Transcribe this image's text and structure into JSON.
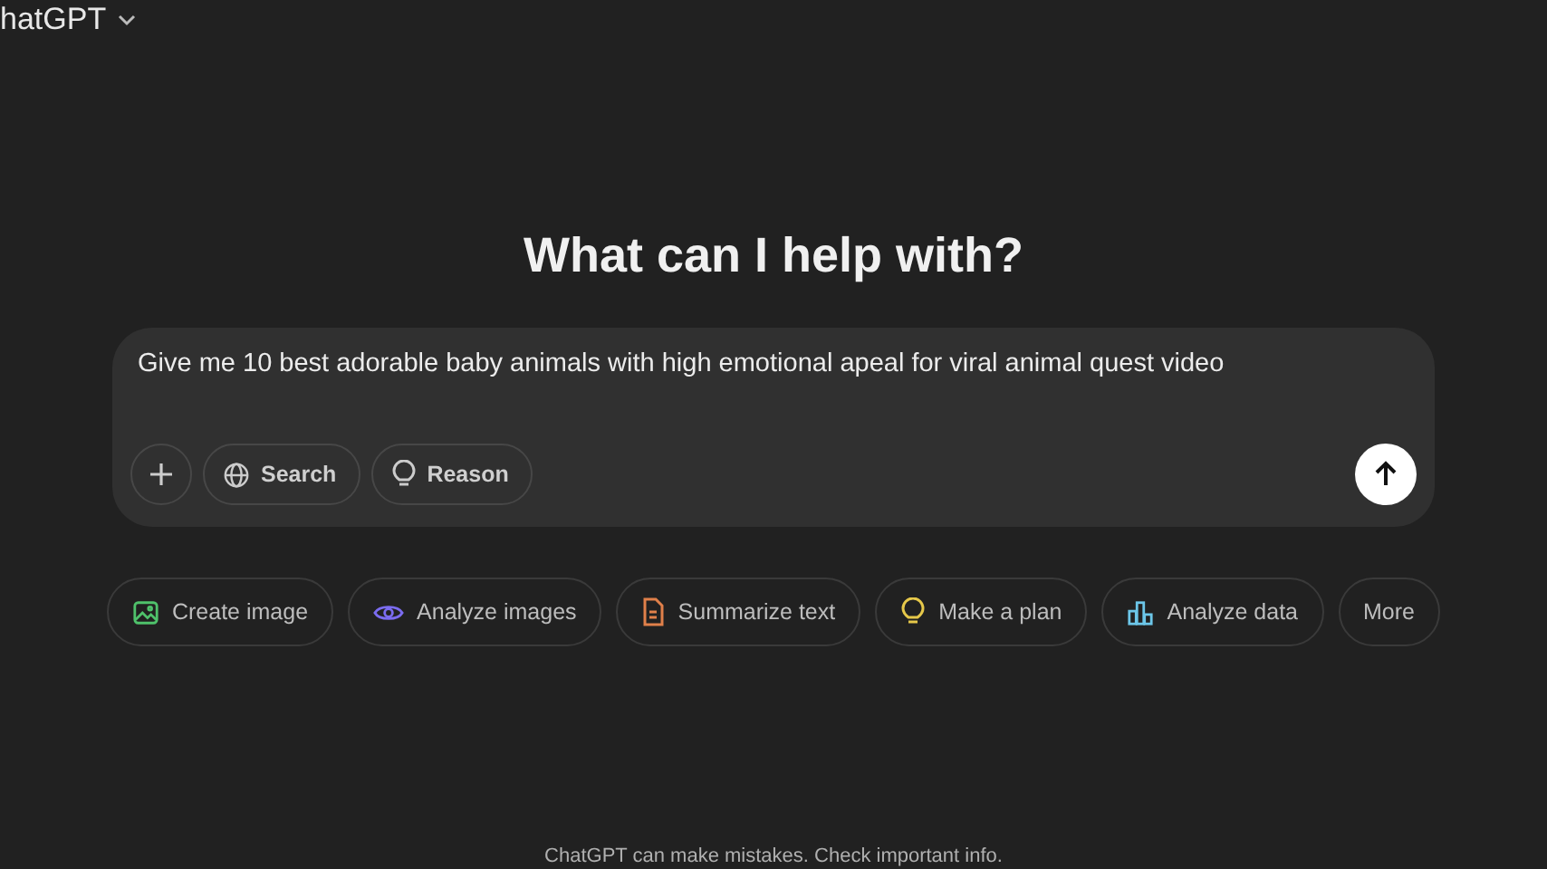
{
  "header": {
    "model_label": "hatGPT"
  },
  "heading": "What can I help with?",
  "composer": {
    "value": "Give me 10 best adorable baby animals with high emotional apeal for viral animal quest video ",
    "tools": [
      {
        "kind": "plus"
      },
      {
        "kind": "globe",
        "label": "Search"
      },
      {
        "kind": "bulb",
        "label": "Reason"
      }
    ]
  },
  "suggestions": [
    {
      "kind": "image",
      "label": "Create image",
      "color": "#4fc26b"
    },
    {
      "kind": "eye",
      "label": "Analyze images",
      "color": "#7b6cf0"
    },
    {
      "kind": "doc",
      "label": "Summarize text",
      "color": "#e0804a"
    },
    {
      "kind": "bulb",
      "label": "Make a plan",
      "color": "#e6c84a"
    },
    {
      "kind": "chart",
      "label": "Analyze data",
      "color": "#6cc6e8"
    },
    {
      "kind": "none",
      "label": "More"
    }
  ],
  "footer": "ChatGPT can make mistakes. Check important info."
}
